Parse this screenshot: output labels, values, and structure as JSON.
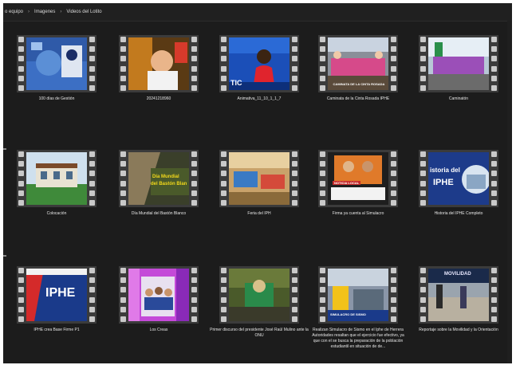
{
  "breadcrumb": [
    "o equipo",
    "Imagenes",
    "Videos del Lotito"
  ],
  "separator": "›",
  "items": [
    {
      "caption": "100 días de Gestión"
    },
    {
      "caption": "20241218960"
    },
    {
      "caption": "Animativa_11_10_1_1_7"
    },
    {
      "caption": "Caminata de la Cinta Rosada IPHE"
    },
    {
      "caption": "Caminatón"
    },
    {
      "caption": "Colocación"
    },
    {
      "caption": "Día Mundial del Bastón Blanco"
    },
    {
      "caption": "Feria del IPH"
    },
    {
      "caption": "Firma ya cuenta al Simulacro"
    },
    {
      "caption": "Historia del IPHE Completo"
    },
    {
      "caption": "IPHE crea Base Firme P1"
    },
    {
      "caption": "Los Creas"
    },
    {
      "caption": "Primer discurso del presidente José Raúl Mulino ante la ONU"
    },
    {
      "caption": "Realizan Simulacro de Sismo en el Iphe de Herrera Autoridades resaltan que el ejercicio fue efectivo, ya que con el se busca la preparación de la población estudiantil en situación de de..."
    },
    {
      "caption": "Reportaje sobre la Movilidad y la Orientación"
    }
  ],
  "thumbnail_text": {
    "t3_overlay": "TIC",
    "t4_banner": "CAMINATA DE LA CINTA ROSADA",
    "t7_line1": "Día Mundial",
    "t7_line2": "del Bastón Blan",
    "t9_badge": "NOTICIA LOCAL",
    "t10_line1": "istoria del",
    "t10_line2": "IPHE",
    "t11_big": "IPHE",
    "t14_strip": "SIMULACRO DE SISMO",
    "t15_title": "MOVILIDAD"
  },
  "colors": {
    "background": "#1c1c1c",
    "film_strip": "#3b3b3b",
    "sprocket": "#c9c9c9",
    "caption_text": "#e6e6e6"
  }
}
